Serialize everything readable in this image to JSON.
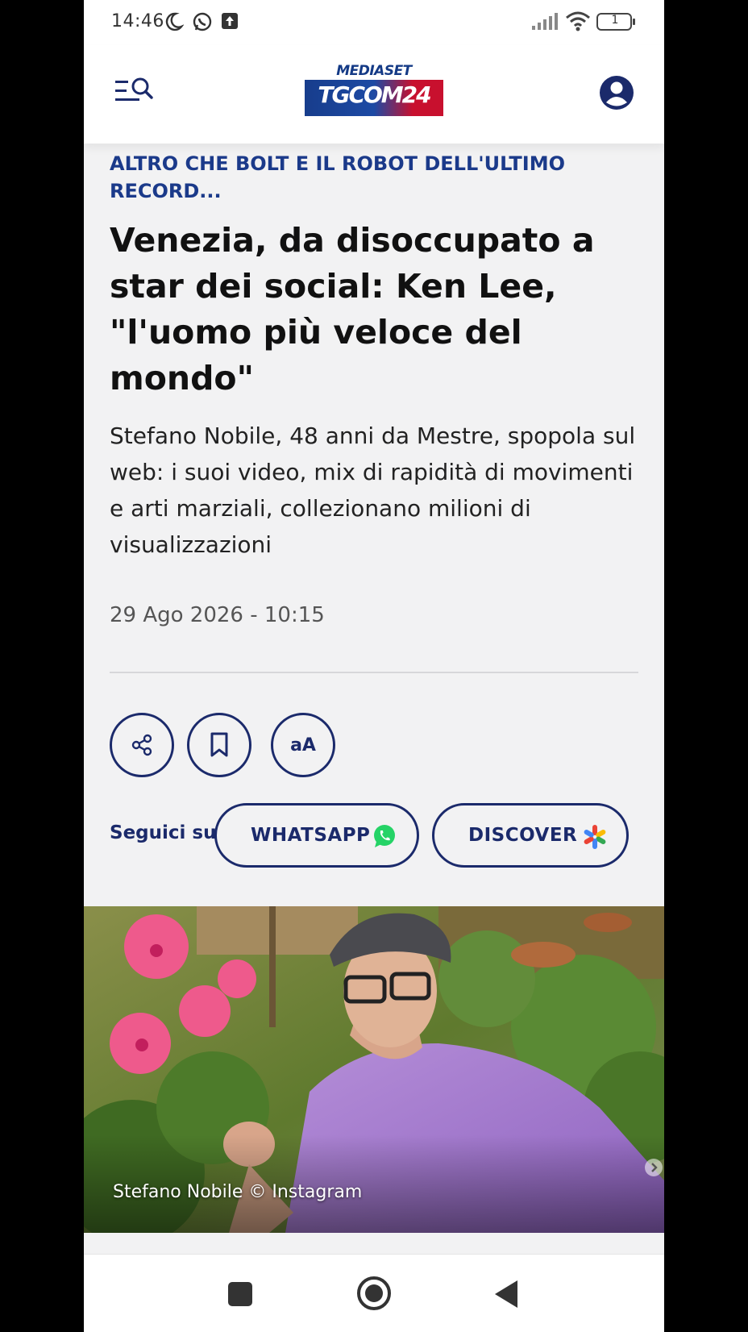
{
  "status_bar": {
    "time": "14:46",
    "battery_level": "1"
  },
  "header": {
    "logo_top": "MEDIASET",
    "logo_main": "TGCOM24"
  },
  "article": {
    "kicker": "ALTRO CHE BOLT E IL ROBOT DELL'ULTIMO RECORD...",
    "headline": "Venezia, da disoccupato a star dei social: Ken Lee, \"l'uomo più veloce del mondo\"",
    "summary": "Stefano Nobile, 48 anni da Mestre, spopola sul web: i suoi video, mix di rapidità di movimenti e arti marziali, collezionano milioni di visualizzazioni",
    "date": "29 Ago 2026 - 10:15"
  },
  "actions": {
    "font_label": "aA"
  },
  "follow": {
    "label": "Seguici su",
    "whatsapp": "WHATSAPP",
    "discover": "DISCOVER"
  },
  "image": {
    "caption": "Stefano Nobile © Instagram"
  },
  "colors": {
    "brand_navy": "#1b2a6b",
    "kicker_blue": "#1b3a8a",
    "whatsapp_green": "#25d366"
  }
}
